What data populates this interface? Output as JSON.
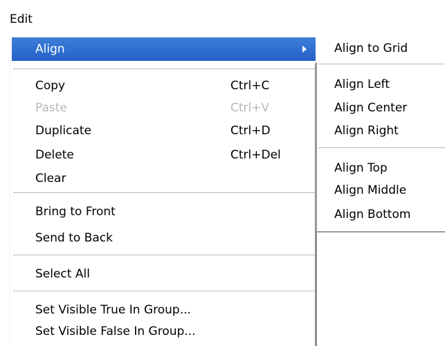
{
  "menubar": {
    "title": "Edit"
  },
  "menu": {
    "highlight_color": "#2a66cc",
    "items": [
      {
        "label": "Align",
        "shortcut": "",
        "has_submenu": true
      },
      {
        "label": "Copy",
        "shortcut": "Ctrl+C"
      },
      {
        "label": "Paste",
        "shortcut": "Ctrl+V",
        "disabled": true
      },
      {
        "label": "Duplicate",
        "shortcut": "Ctrl+D"
      },
      {
        "label": "Delete",
        "shortcut": "Ctrl+Del"
      },
      {
        "label": "Clear",
        "shortcut": ""
      },
      {
        "label": "Bring to Front",
        "shortcut": ""
      },
      {
        "label": "Send to Back",
        "shortcut": ""
      },
      {
        "label": "Select All",
        "shortcut": ""
      },
      {
        "label": "Set Visible True In Group...",
        "shortcut": ""
      },
      {
        "label": "Set Visible False In Group...",
        "shortcut": ""
      }
    ]
  },
  "submenu": {
    "items": [
      {
        "label": "Align to Grid"
      },
      {
        "label": "Align Left"
      },
      {
        "label": "Align Center"
      },
      {
        "label": "Align Right"
      },
      {
        "label": "Align Top"
      },
      {
        "label": "Align Middle"
      },
      {
        "label": "Align Bottom"
      }
    ]
  }
}
